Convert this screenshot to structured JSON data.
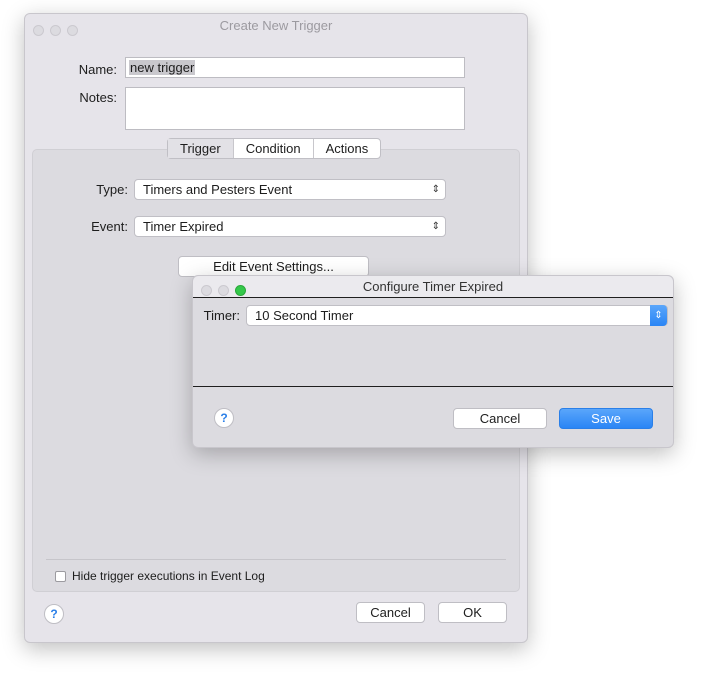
{
  "main_window": {
    "title": "Create New Trigger",
    "name_label": "Name:",
    "name_value": "new trigger",
    "notes_label": "Notes:",
    "notes_value": "",
    "tabs": [
      {
        "label": "Trigger",
        "active": true
      },
      {
        "label": "Condition",
        "active": false
      },
      {
        "label": "Actions",
        "active": false
      }
    ],
    "type_label": "Type:",
    "type_value": "Timers and Pesters Event",
    "event_label": "Event:",
    "event_value": "Timer Expired",
    "edit_button": "Edit Event Settings...",
    "hide_checkbox_label": "Hide trigger executions in Event Log",
    "hide_checkbox_checked": false,
    "help": "?",
    "cancel_button": "Cancel",
    "ok_button": "OK"
  },
  "sub_window": {
    "title": "Configure Timer Expired",
    "timer_label": "Timer:",
    "timer_value": "10 Second Timer",
    "help": "?",
    "cancel_button": "Cancel",
    "save_button": "Save"
  },
  "icons": {
    "popup_arrows": "up-down-chevron-icon"
  },
  "colors": {
    "accent": "#2a85f5",
    "green_light": "#34c84a"
  }
}
